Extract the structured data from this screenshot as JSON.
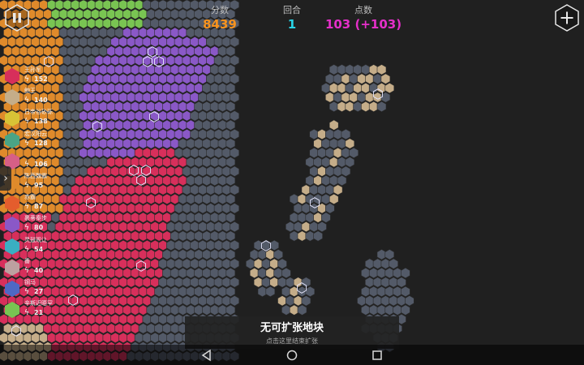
{
  "header": {
    "score_label": "分数",
    "score_value": "8439",
    "round_label": "回合",
    "round_value": "1",
    "points_label": "点数",
    "points_value": "103 (+103)"
  },
  "colors": {
    "background": "#202020",
    "empty_hex": "#535a68",
    "purple": "#8a58c7",
    "crimson": "#d72f5b",
    "orange": "#df8a2b",
    "tan": "#c5ad89",
    "green": "#79c452",
    "score": "#f7931e",
    "round": "#29d3e6",
    "points": "#e52fc9"
  },
  "players": [
    {
      "name": "王孙军",
      "power": "152",
      "color": "#d72f5b"
    },
    {
      "name": "鲍王",
      "power": "140",
      "color": "#c5ad89"
    },
    {
      "name": "日帝谷砂砾",
      "power": "138",
      "color": "#d8c336"
    },
    {
      "name": "宏汉阳云",
      "power": "128",
      "color": "#4aa486"
    },
    {
      "name": "",
      "power": "106",
      "color": "#d75f86"
    },
    {
      "name": "陈西魏霸",
      "power": "95",
      "color": "#df8a2b"
    },
    {
      "name": "赤霸",
      "power": "87",
      "color": "#e45d2d"
    },
    {
      "name": "裹蒂秦步",
      "power": "80",
      "color": "#8a58c7"
    },
    {
      "name": "灵鼓观让",
      "power": "54",
      "color": "#3aaec2"
    },
    {
      "name": "番",
      "power": "40",
      "color": "#bda0a0"
    },
    {
      "name": "钢马",
      "power": "27",
      "color": "#4f68c4"
    },
    {
      "name": "辛斯近晤罕",
      "power": "21",
      "color": "#79c452"
    }
  ],
  "notice": {
    "title": "无可扩张地块",
    "subtitle": "点击这里结束扩张"
  },
  "side_toggle_glyph": "›",
  "bolt_glyph": "ϟ"
}
